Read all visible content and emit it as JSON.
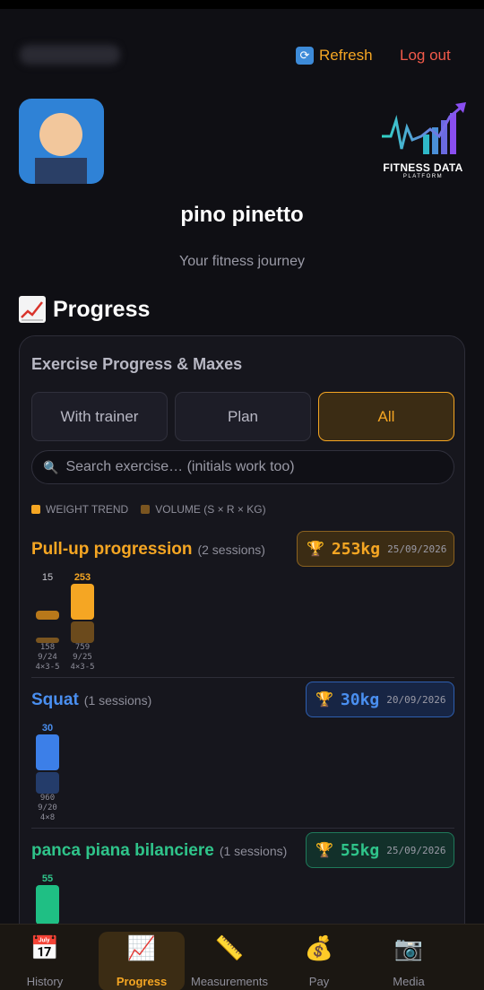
{
  "header": {
    "refresh_label": "Refresh",
    "logout_label": "Log out"
  },
  "profile": {
    "name": "pino pinetto",
    "tagline": "Your fitness journey"
  },
  "logo": {
    "line1": "FITNESS DATA",
    "line2": "PLATFORM"
  },
  "section": {
    "title": "Progress"
  },
  "card": {
    "title": "Exercise Progress & Maxes",
    "tabs": [
      {
        "label": "With trainer"
      },
      {
        "label": "Plan"
      },
      {
        "label": "All"
      }
    ],
    "search_placeholder": "Search exercise… (initials work too)",
    "legend": {
      "weight": "WEIGHT TREND",
      "volume": "VOLUME (S × R × KG)"
    }
  },
  "exercises": [
    {
      "name": "Pull-up progression",
      "sessions": "(2 sessions)",
      "max": "253kg",
      "max_date": "25/09/2026",
      "color": "#f5a623",
      "bars": [
        {
          "weight": "15",
          "volume": "158",
          "date": "9/24",
          "scheme": "4×3-5"
        },
        {
          "weight": "253",
          "volume": "759",
          "date": "9/25",
          "scheme": "4×3-5"
        }
      ]
    },
    {
      "name": "Squat",
      "sessions": "(1 sessions)",
      "max": "30kg",
      "max_date": "20/09/2026",
      "color": "#4a8ff0",
      "bars": [
        {
          "weight": "30",
          "volume": "960",
          "date": "9/20",
          "scheme": "4×8"
        }
      ]
    },
    {
      "name": "panca piana bilanciere",
      "sessions": "(1 sessions)",
      "max": "55kg",
      "max_date": "25/09/2026",
      "color": "#2fc48a",
      "bars": [
        {
          "weight": "55"
        }
      ]
    }
  ],
  "nav": [
    {
      "label": "History",
      "icon": "calendar-icon"
    },
    {
      "label": "Progress",
      "icon": "chart-icon"
    },
    {
      "label": "Measurements",
      "icon": "ruler-icon"
    },
    {
      "label": "Pay",
      "icon": "money-bag-icon"
    },
    {
      "label": "Media",
      "icon": "camera-icon"
    }
  ]
}
